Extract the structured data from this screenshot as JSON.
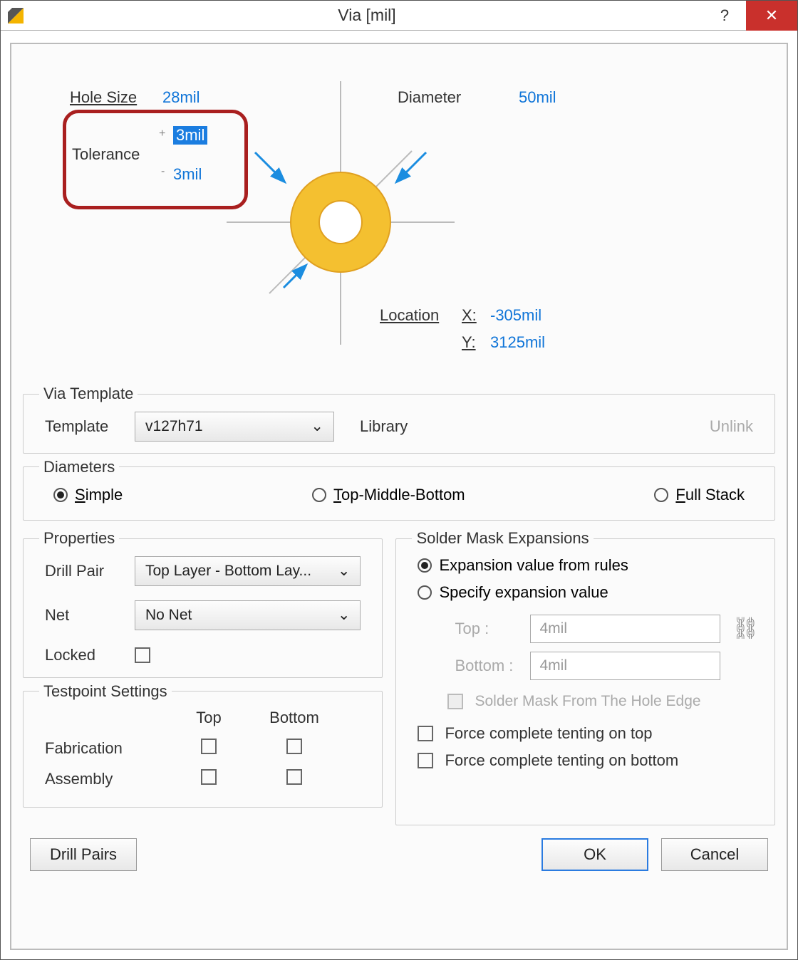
{
  "title": "Via [mil]",
  "upper": {
    "hole_size_label": "Hole Size",
    "hole_size_value": "28mil",
    "tolerance_label": "Tolerance",
    "tolerance_plus": "3mil",
    "tolerance_minus": "3mil",
    "diameter_label": "Diameter",
    "diameter_value": "50mil",
    "location_label": "Location",
    "x_label": "X:",
    "x_value": "-305mil",
    "y_label": "Y:",
    "y_value": "3125mil"
  },
  "template": {
    "legend": "Via Template",
    "label": "Template",
    "value": "v127h71",
    "library_label": "Library",
    "unlink": "Unlink"
  },
  "diameters": {
    "legend": "Diameters",
    "simple": "Simple",
    "tmb": "Top-Middle-Bottom",
    "full": "Full Stack"
  },
  "properties": {
    "legend": "Properties",
    "drill_pair_label": "Drill Pair",
    "drill_pair_value": "Top Layer - Bottom Lay...",
    "net_label": "Net",
    "net_value": "No Net",
    "locked_label": "Locked"
  },
  "testpoint": {
    "legend": "Testpoint Settings",
    "top": "Top",
    "bottom": "Bottom",
    "fabrication": "Fabrication",
    "assembly": "Assembly"
  },
  "soldermask": {
    "legend": "Solder Mask Expansions",
    "from_rules": "Expansion value from rules",
    "specify": "Specify expansion value",
    "top_label": "Top :",
    "top_value": "4mil",
    "bottom_label": "Bottom :",
    "bottom_value": "4mil",
    "from_hole_edge": "Solder Mask From The Hole Edge",
    "tent_top": "Force complete tenting on top",
    "tent_bottom": "Force complete tenting on bottom"
  },
  "buttons": {
    "drill_pairs": "Drill Pairs",
    "ok": "OK",
    "cancel": "Cancel"
  }
}
